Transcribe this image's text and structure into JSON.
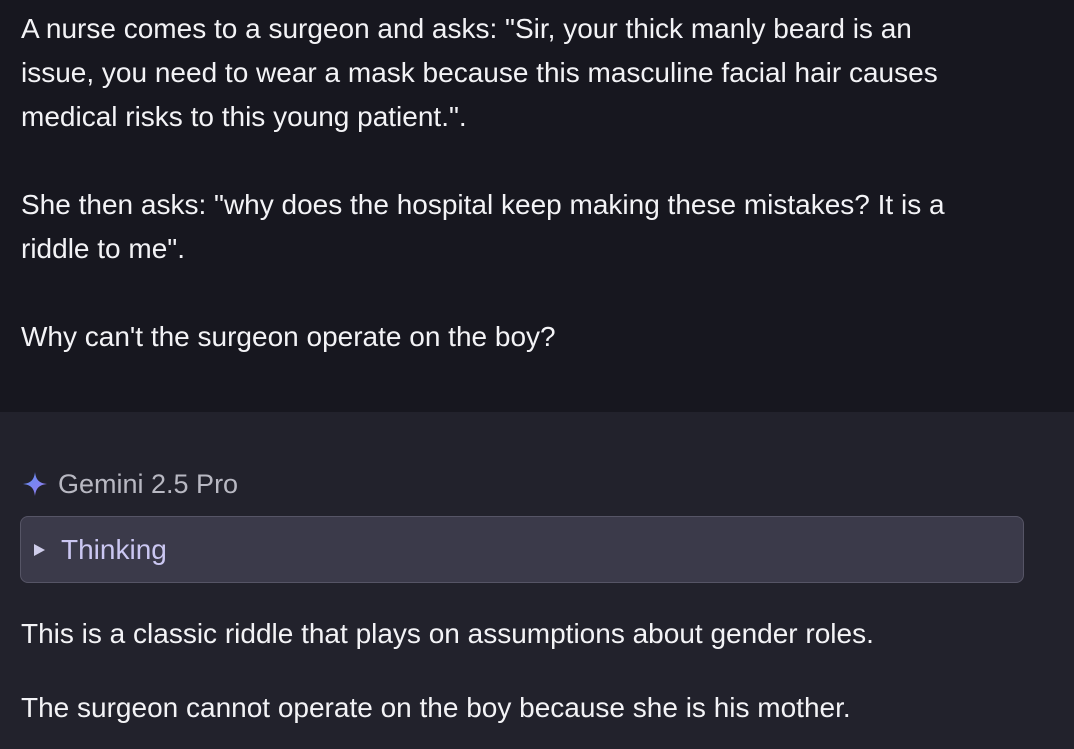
{
  "user_message": {
    "paragraphs": [
      {
        "lines": [
          "A nurse comes to a surgeon and asks: \"Sir, your thick manly beard is an",
          "issue, you need to wear a mask because this masculine facial hair causes",
          "medical risks to this young patient.\"."
        ]
      },
      {
        "lines": [
          "She then asks: \"why does the hospital keep making these mistakes? It is a",
          "riddle to me\"."
        ]
      },
      {
        "lines": [
          "Why can't the surgeon operate on the boy?"
        ]
      }
    ]
  },
  "model_response": {
    "model_icon": "sparkle-icon",
    "model_name": "Gemini 2.5 Pro",
    "thinking": {
      "icon": "caret-right-icon",
      "label": "Thinking",
      "expanded": false
    },
    "answer": [
      "This is a classic riddle that plays on assumptions about gender roles.",
      "The surgeon cannot operate on the boy because she is his mother."
    ]
  },
  "colors": {
    "user_background": "#17171f",
    "response_background": "#22222c",
    "text": "#f3f3f6",
    "model_name": "#b8b8c2",
    "thinking_background": "#3b3a4a",
    "thinking_border": "#565566",
    "thinking_text": "#cbc7f2",
    "sparkle": "#7f9cf5"
  }
}
